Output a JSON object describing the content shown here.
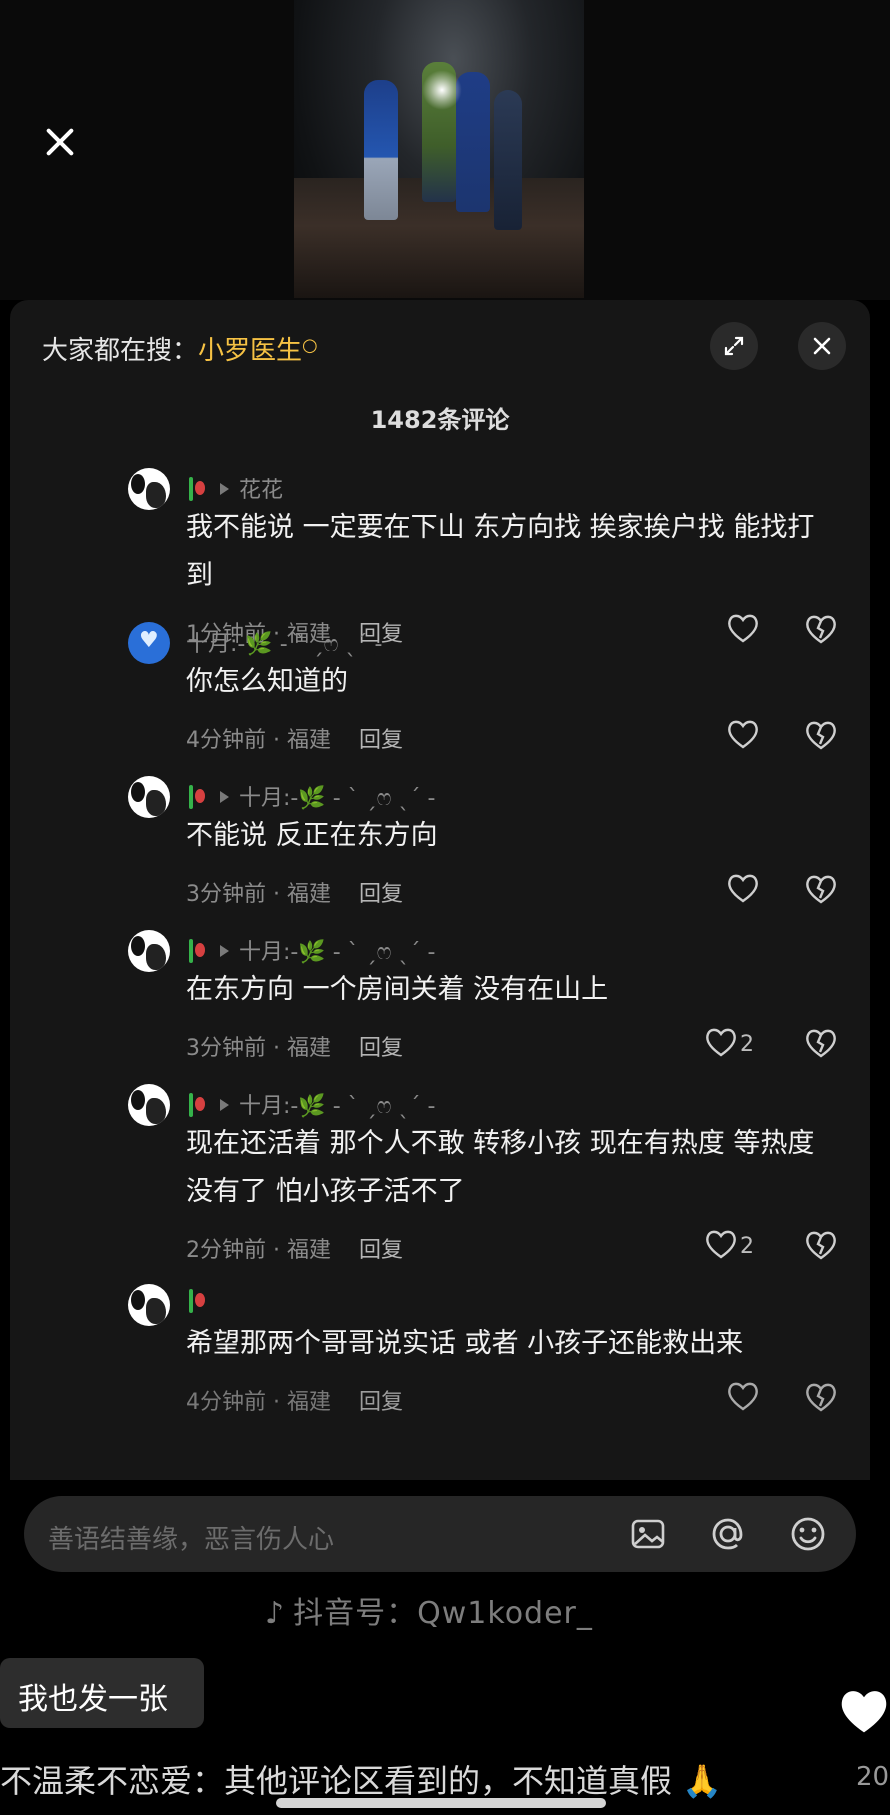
{
  "search": {
    "prefix": "大家都在搜：",
    "term": "小罗医生"
  },
  "comment_count": "1482条评论",
  "comments": [
    {
      "avatar": "panda",
      "reply_to": "花花",
      "text": "我不能说 一定要在下山 东方向找 挨家挨户找 能找打到",
      "time": "1分钟前 · 福建",
      "reply_label": "回复",
      "likes": ""
    },
    {
      "avatar": "blue-heart",
      "author": "十月:-🌿 - ˋ ˏෆ ˎˊ -",
      "text": "你怎么知道的",
      "time": "4分钟前 · 福建",
      "reply_label": "回复",
      "likes": ""
    },
    {
      "avatar": "panda",
      "reply_to": "十月:-🌿 - ˋ ˏෆ ˎˊ -",
      "text": "不能说 反正在东方向",
      "time": "3分钟前 · 福建",
      "reply_label": "回复",
      "likes": ""
    },
    {
      "avatar": "panda",
      "reply_to": "十月:-🌿 - ˋ ˏෆ ˎˊ -",
      "text": "在东方向 一个房间关着 没有在山上",
      "time": "3分钟前 · 福建",
      "reply_label": "回复",
      "likes": "2"
    },
    {
      "avatar": "panda",
      "reply_to": "十月:-🌿 - ˋ ˏෆ ˎˊ -",
      "text": "现在还活着 那个人不敢 转移小孩 现在有热度 等热度没有了 怕小孩子活不了",
      "time": "2分钟前 · 福建",
      "reply_label": "回复",
      "likes": "2"
    },
    {
      "avatar": "panda",
      "reply_to": "",
      "text": "希望那两个哥哥说实话 或者 小孩子还能救出来",
      "time": "4分钟前 · 福建",
      "reply_label": "回复",
      "likes": ""
    }
  ],
  "input": {
    "placeholder": "善语结善缘，恶言伤人心"
  },
  "input_icons": [
    "image-icon",
    "at-icon",
    "emoji-icon"
  ],
  "watermark": "抖音号：Qw1koder_",
  "reply_chip": "我也发一张",
  "caption": "不温柔不恋爱：其他评论区看到的，不知道真假 🙏",
  "caption_right": "20"
}
